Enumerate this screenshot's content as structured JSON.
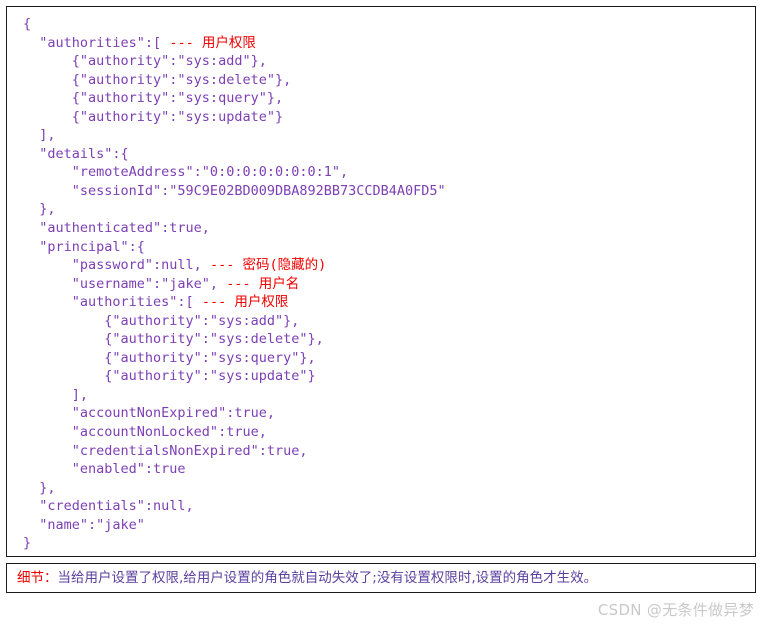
{
  "code_block": {
    "language": "json",
    "lines": [
      {
        "code": "{",
        "note": ""
      },
      {
        "code": "  \"authorities\":[ ",
        "note": "--- 用户权限"
      },
      {
        "code": "      {\"authority\":\"sys:add\"},",
        "note": ""
      },
      {
        "code": "      {\"authority\":\"sys:delete\"},",
        "note": ""
      },
      {
        "code": "      {\"authority\":\"sys:query\"},",
        "note": ""
      },
      {
        "code": "      {\"authority\":\"sys:update\"}",
        "note": ""
      },
      {
        "code": "  ],",
        "note": ""
      },
      {
        "code": "  \"details\":{",
        "note": ""
      },
      {
        "code": "      \"remoteAddress\":\"0:0:0:0:0:0:0:1\",",
        "note": ""
      },
      {
        "code": "      \"sessionId\":\"59C9E02BD009DBA892BB73CCDB4A0FD5\"",
        "note": ""
      },
      {
        "code": "  },",
        "note": ""
      },
      {
        "code": "  \"authenticated\":true,",
        "note": ""
      },
      {
        "code": "  \"principal\":{",
        "note": ""
      },
      {
        "code": "      \"password\":null, ",
        "note": "--- 密码(隐藏的)"
      },
      {
        "code": "      \"username\":\"jake\", ",
        "note": "--- 用户名"
      },
      {
        "code": "      \"authorities\":[ ",
        "note": "--- 用户权限"
      },
      {
        "code": "          {\"authority\":\"sys:add\"},",
        "note": ""
      },
      {
        "code": "          {\"authority\":\"sys:delete\"},",
        "note": ""
      },
      {
        "code": "          {\"authority\":\"sys:query\"},",
        "note": ""
      },
      {
        "code": "          {\"authority\":\"sys:update\"}",
        "note": ""
      },
      {
        "code": "      ],",
        "note": ""
      },
      {
        "code": "      \"accountNonExpired\":true,",
        "note": ""
      },
      {
        "code": "      \"accountNonLocked\":true,",
        "note": ""
      },
      {
        "code": "      \"credentialsNonExpired\":true,",
        "note": ""
      },
      {
        "code": "      \"enabled\":true",
        "note": ""
      },
      {
        "code": "  },",
        "note": ""
      },
      {
        "code": "  \"credentials\":null,",
        "note": ""
      },
      {
        "code": "  \"name\":\"jake\"",
        "note": ""
      },
      {
        "code": "}",
        "note": ""
      }
    ]
  },
  "detail_note": {
    "label": "细节：",
    "body": "当给用户设置了权限,给用户设置的角色就自动失效了;没有设置权限时,设置的角色才生效。"
  },
  "watermark": {
    "text": "CSDN @无条件做异梦"
  },
  "colors": {
    "code_text": "#7d3fb5",
    "annotation_red": "#ee0000",
    "detail_body": "#5b3f9e",
    "border": "#1a1a1a",
    "background": "#ffffff",
    "watermark": "#c9c9c9"
  }
}
